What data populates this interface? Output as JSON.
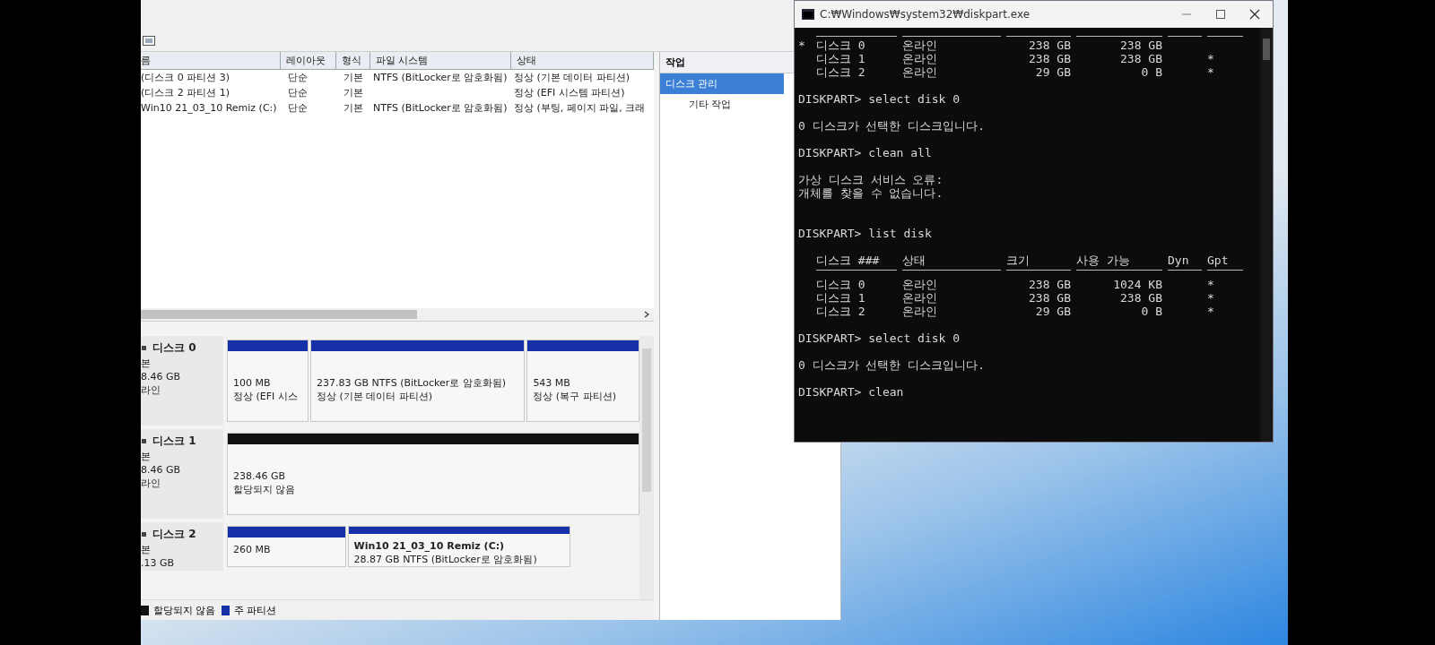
{
  "disk_management": {
    "volume_table": {
      "columns": [
        "름",
        "레이아웃",
        "형식",
        "파일 시스템",
        "상태"
      ],
      "rows": [
        {
          "name": "(디스크 0 파티션 3)",
          "layout": "단순",
          "type": "기본",
          "file_system": "NTFS (BitLocker로 암호화됨)",
          "status": "정상 (기본 데이터 파티션)"
        },
        {
          "name": "(디스크 2 파티션 1)",
          "layout": "단순",
          "type": "기본",
          "status": "정상 (EFI 시스템 파티션)"
        },
        {
          "name": "Win10 21_03_10 Remiz (C:)",
          "layout": "단순",
          "type": "기본",
          "file_system": "NTFS (BitLocker로 암호화됨)",
          "status": "정상 (부팅, 페이지 파일, 크래"
        }
      ]
    },
    "actions": {
      "title": "작업",
      "items": [
        {
          "label": "디스크 관리",
          "selected": true,
          "sub": false
        },
        {
          "label": "기타 작업",
          "selected": false,
          "sub": true
        }
      ]
    },
    "disks": [
      {
        "name": "디스크 0",
        "type": "본",
        "size": "8.46 GB",
        "status": "라인",
        "partitions": [
          {
            "kind": "primary",
            "lines": [
              "100 MB",
              "정상 (EFI 시스"
            ]
          },
          {
            "kind": "primary",
            "lines": [
              "237.83 GB NTFS (BitLocker로 암호화됨)",
              "정상 (기본 데이터 파티션)"
            ]
          },
          {
            "kind": "primary",
            "lines": [
              "543 MB",
              "정상 (복구 파티션)"
            ]
          }
        ]
      },
      {
        "name": "디스크 1",
        "type": "본",
        "size": "8.46 GB",
        "status": "라인",
        "partitions": [
          {
            "kind": "unallocated",
            "lines": [
              "238.46 GB",
              "할당되지 않음"
            ]
          }
        ]
      },
      {
        "name": "디스크 2",
        "type": "본",
        "size": ".13 GB",
        "partitions": [
          {
            "kind": "primary",
            "lines": [
              "260 MB"
            ]
          },
          {
            "kind": "primary",
            "title": "Win10 21_03_10 Remiz  (C:)",
            "lines": [
              "28.87 GB NTFS (BitLocker로 암호화됨)"
            ]
          }
        ]
      }
    ],
    "legend": [
      {
        "kind": "unallocated",
        "label": "할당되지 않음"
      },
      {
        "kind": "primary",
        "label": "주 파티션"
      }
    ]
  },
  "console": {
    "title": "C:₩Windows₩system32₩diskpart.exe",
    "blocks": [
      {
        "kind": "table",
        "rows": [
          {
            "marker": "*",
            "disk": "디스크 0",
            "status": "온라인",
            "size": "238 GB",
            "free": "238 GB"
          },
          {
            "disk": "디스크 1",
            "status": "온라인",
            "size": "238 GB",
            "free": "238 GB",
            "gpt": "*"
          },
          {
            "disk": "디스크 2",
            "status": "온라인",
            "size": "29 GB",
            "free": "0 B",
            "gpt": "*"
          }
        ]
      },
      {
        "kind": "text",
        "lines": [
          "DISKPART> select disk 0"
        ]
      },
      {
        "kind": "text",
        "lines": [
          "0 디스크가 선택한 디스크입니다."
        ]
      },
      {
        "kind": "text",
        "lines": [
          "DISKPART> clean all"
        ]
      },
      {
        "kind": "text",
        "lines": [
          "가상 디스크 서비스 오류:",
          "개체를 찾을 수 없습니다."
        ]
      },
      {
        "kind": "text",
        "lines": [
          "DISKPART> list disk"
        ]
      },
      {
        "kind": "table",
        "columns": [
          "디스크 ###",
          "상태",
          "크기",
          "사용 가능",
          "Dyn",
          "Gpt"
        ],
        "rows": [
          {
            "disk": "디스크 0",
            "status": "온라인",
            "size": "238 GB",
            "free": "1024 KB",
            "gpt": "*"
          },
          {
            "disk": "디스크 1",
            "status": "온라인",
            "size": "238 GB",
            "free": "238 GB",
            "gpt": "*"
          },
          {
            "disk": "디스크 2",
            "status": "온라인",
            "size": "29 GB",
            "free": "0 B",
            "gpt": "*"
          }
        ]
      },
      {
        "kind": "text",
        "lines": [
          "DISKPART> select disk 0"
        ]
      },
      {
        "kind": "text",
        "lines": [
          "0 디스크가 선택한 디스크입니다."
        ]
      },
      {
        "kind": "text",
        "lines": [
          "DISKPART> clean"
        ]
      }
    ]
  }
}
